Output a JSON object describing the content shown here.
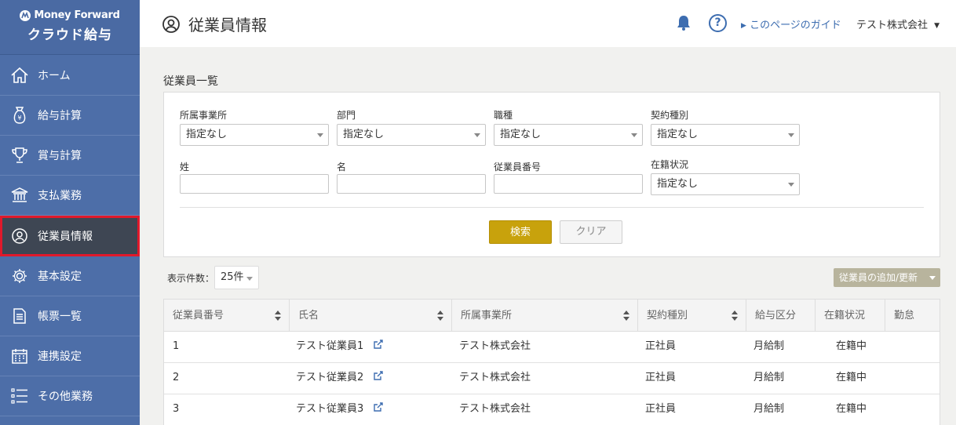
{
  "brand": {
    "top": "Money Forward",
    "bottom": "クラウド給与"
  },
  "sidebar": {
    "items": [
      {
        "label": "ホーム",
        "icon": "home-icon"
      },
      {
        "label": "給与計算",
        "icon": "money-bag-icon"
      },
      {
        "label": "賞与計算",
        "icon": "trophy-icon"
      },
      {
        "label": "支払業務",
        "icon": "bank-icon"
      },
      {
        "label": "従業員情報",
        "icon": "employee-icon",
        "active": true
      },
      {
        "label": "基本設定",
        "icon": "gear-icon"
      },
      {
        "label": "帳票一覧",
        "icon": "document-icon"
      },
      {
        "label": "連携設定",
        "icon": "calendar-icon"
      },
      {
        "label": "その他業務",
        "icon": "list-icon"
      }
    ]
  },
  "header": {
    "title": "従業員情報",
    "help": "?",
    "guide": "このページのガイド",
    "company": "テスト株式会社"
  },
  "filters": {
    "section_title": "従業員一覧",
    "office_label": "所属事業所",
    "office_value": "指定なし",
    "department_label": "部門",
    "department_value": "指定なし",
    "job_label": "職種",
    "job_value": "指定なし",
    "contract_label": "契約種別",
    "contract_value": "指定なし",
    "last_name_label": "姓",
    "first_name_label": "名",
    "employee_number_label": "従業員番号",
    "status_label": "在籍状況",
    "status_value": "指定なし",
    "search_button": "検索",
    "clear_button": "クリア"
  },
  "list": {
    "count_label": "表示件数：",
    "count_value": "25件",
    "add_button": "従業員の追加/更新"
  },
  "table": {
    "headers": [
      "従業員番号",
      "氏名",
      "所属事業所",
      "契約種別",
      "給与区分",
      "在籍状況",
      "勤怠"
    ],
    "rows": [
      [
        "1",
        "テスト従業員1",
        "テスト株式会社",
        "正社員",
        "月給制",
        "在籍中",
        ""
      ],
      [
        "2",
        "テスト従業員2",
        "テスト株式会社",
        "正社員",
        "月給制",
        "在籍中",
        ""
      ],
      [
        "3",
        "テスト従業員3",
        "テスト株式会社",
        "正社員",
        "月給制",
        "在籍中",
        ""
      ]
    ]
  },
  "colors": {
    "sidebar": "#4d6ea8",
    "active_item": "#3e4653",
    "active_border": "#e0192b",
    "link": "#3d6db0",
    "search_button": "#c8a20c",
    "add_button": "#b8b49d"
  }
}
